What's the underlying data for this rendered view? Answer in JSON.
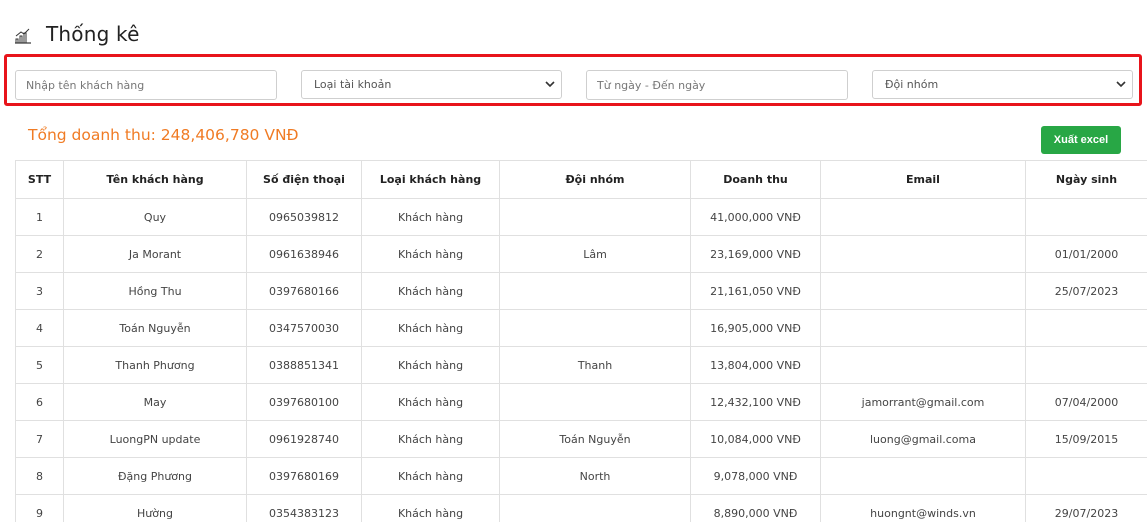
{
  "header": {
    "title": "Thống kê",
    "icon": "chart-bar-icon"
  },
  "filters": {
    "customer_name_placeholder": "Nhập tên khách hàng",
    "account_type_selected": "Loại tài khoản",
    "date_range_placeholder": "Từ ngày - Đến ngày",
    "team_selected": "Đội nhóm"
  },
  "summary": {
    "total_revenue": "Tổng doanh thu: 248,406,780 VNĐ"
  },
  "actions": {
    "export_label": "Xuất excel"
  },
  "colors": {
    "accent_orange": "#f07b24",
    "export_green": "#28a745",
    "highlight_red": "#e8141b"
  },
  "table": {
    "headers": [
      "STT",
      "Tên khách hàng",
      "Số điện thoại",
      "Loại khách hàng",
      "Đội nhóm",
      "Doanh thu",
      "Email",
      "Ngày sinh"
    ],
    "rows": [
      [
        "1",
        "Quy",
        "0965039812",
        "Khách hàng",
        "",
        "41,000,000 VNĐ",
        "",
        ""
      ],
      [
        "2",
        "Ja Morant",
        "0961638946",
        "Khách hàng",
        "Lâm",
        "23,169,000 VNĐ",
        "",
        "01/01/2000"
      ],
      [
        "3",
        "Hồng Thu",
        "0397680166",
        "Khách hàng",
        "",
        "21,161,050 VNĐ",
        "",
        "25/07/2023"
      ],
      [
        "4",
        "Toán Nguyễn",
        "0347570030",
        "Khách hàng",
        "",
        "16,905,000 VNĐ",
        "",
        ""
      ],
      [
        "5",
        "Thanh Phương",
        "0388851341",
        "Khách hàng",
        "Thanh",
        "13,804,000 VNĐ",
        "",
        ""
      ],
      [
        "6",
        "May",
        "0397680100",
        "Khách hàng",
        "",
        "12,432,100 VNĐ",
        "jamorrant@gmail.com",
        "07/04/2000"
      ],
      [
        "7",
        "LuongPN update",
        "0961928740",
        "Khách hàng",
        "Toán Nguyễn",
        "10,084,000 VNĐ",
        "luong@gmail.coma",
        "15/09/2015"
      ],
      [
        "8",
        "Đặng Phương",
        "0397680169",
        "Khách hàng",
        "North",
        "9,078,000 VNĐ",
        "",
        ""
      ],
      [
        "9",
        "Hường",
        "0354383123",
        "Khách hàng",
        "",
        "8,890,000 VNĐ",
        "huongnt@winds.vn",
        "29/07/2023"
      ]
    ]
  }
}
